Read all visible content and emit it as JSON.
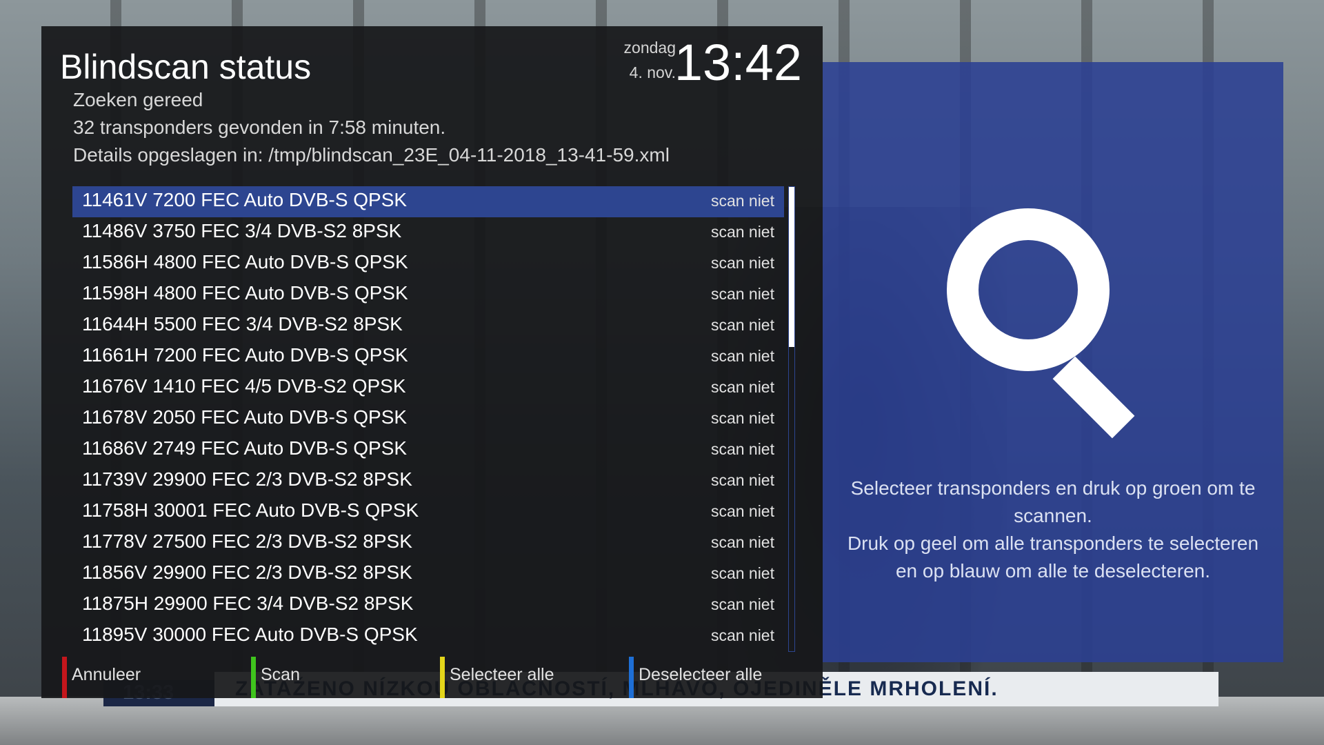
{
  "background": {
    "ticker_text": "ZATAŽENO NÍZKOU OBLAČNOSTÍ, MLHAVO, OJEDINĚLE MRHOLENÍ.",
    "ticker_clock": "13:33"
  },
  "header": {
    "title": "Blindscan status",
    "day": "zondag",
    "date": "4. nov.",
    "time": "13:42"
  },
  "status": {
    "line1": "Zoeken gereed",
    "line2": "32 transponders gevonden in 7:58 minuten.",
    "line3": "Details opgeslagen in: /tmp/blindscan_23E_04-11-2018_13-41-59.xml"
  },
  "transponders": [
    {
      "label": "11461V 7200 FEC Auto DVB-S QPSK",
      "status": "scan niet"
    },
    {
      "label": "11486V 3750 FEC 3/4 DVB-S2 8PSK",
      "status": "scan niet"
    },
    {
      "label": "11586H 4800 FEC Auto DVB-S QPSK",
      "status": "scan niet"
    },
    {
      "label": "11598H 4800 FEC Auto DVB-S QPSK",
      "status": "scan niet"
    },
    {
      "label": "11644H 5500 FEC 3/4 DVB-S2 8PSK",
      "status": "scan niet"
    },
    {
      "label": "11661H 7200 FEC Auto DVB-S QPSK",
      "status": "scan niet"
    },
    {
      "label": "11676V 1410 FEC 4/5 DVB-S2 QPSK",
      "status": "scan niet"
    },
    {
      "label": "11678V 2050 FEC Auto DVB-S QPSK",
      "status": "scan niet"
    },
    {
      "label": "11686V 2749 FEC Auto DVB-S QPSK",
      "status": "scan niet"
    },
    {
      "label": "11739V 29900 FEC 2/3 DVB-S2 8PSK",
      "status": "scan niet"
    },
    {
      "label": "11758H 30001 FEC Auto DVB-S QPSK",
      "status": "scan niet"
    },
    {
      "label": "11778V 27500 FEC 2/3 DVB-S2 8PSK",
      "status": "scan niet"
    },
    {
      "label": "11856V 29900 FEC 2/3 DVB-S2 8PSK",
      "status": "scan niet"
    },
    {
      "label": "11875H 29900 FEC 3/4 DVB-S2 8PSK",
      "status": "scan niet"
    },
    {
      "label": "11895V 30000 FEC Auto DVB-S QPSK",
      "status": "scan niet"
    }
  ],
  "selected_index": 0,
  "buttons": {
    "red": {
      "label": "Annuleer",
      "color": "#c4161c"
    },
    "green": {
      "label": "Scan",
      "color": "#3fc41d"
    },
    "yellow": {
      "label": "Selecteer alle",
      "color": "#e3d51a"
    },
    "blue": {
      "label": "Deselecteer alle",
      "color": "#1e6fd6"
    }
  },
  "help": {
    "icon": "search-icon",
    "line1": "Selecteer transponders en druk op groen om te scannen.",
    "line2": "Druk op geel om alle transponders te selecteren en op blauw om alle te deselecteren."
  },
  "colors": {
    "selection": "#2d4590",
    "help_panel": "#2b4093"
  }
}
